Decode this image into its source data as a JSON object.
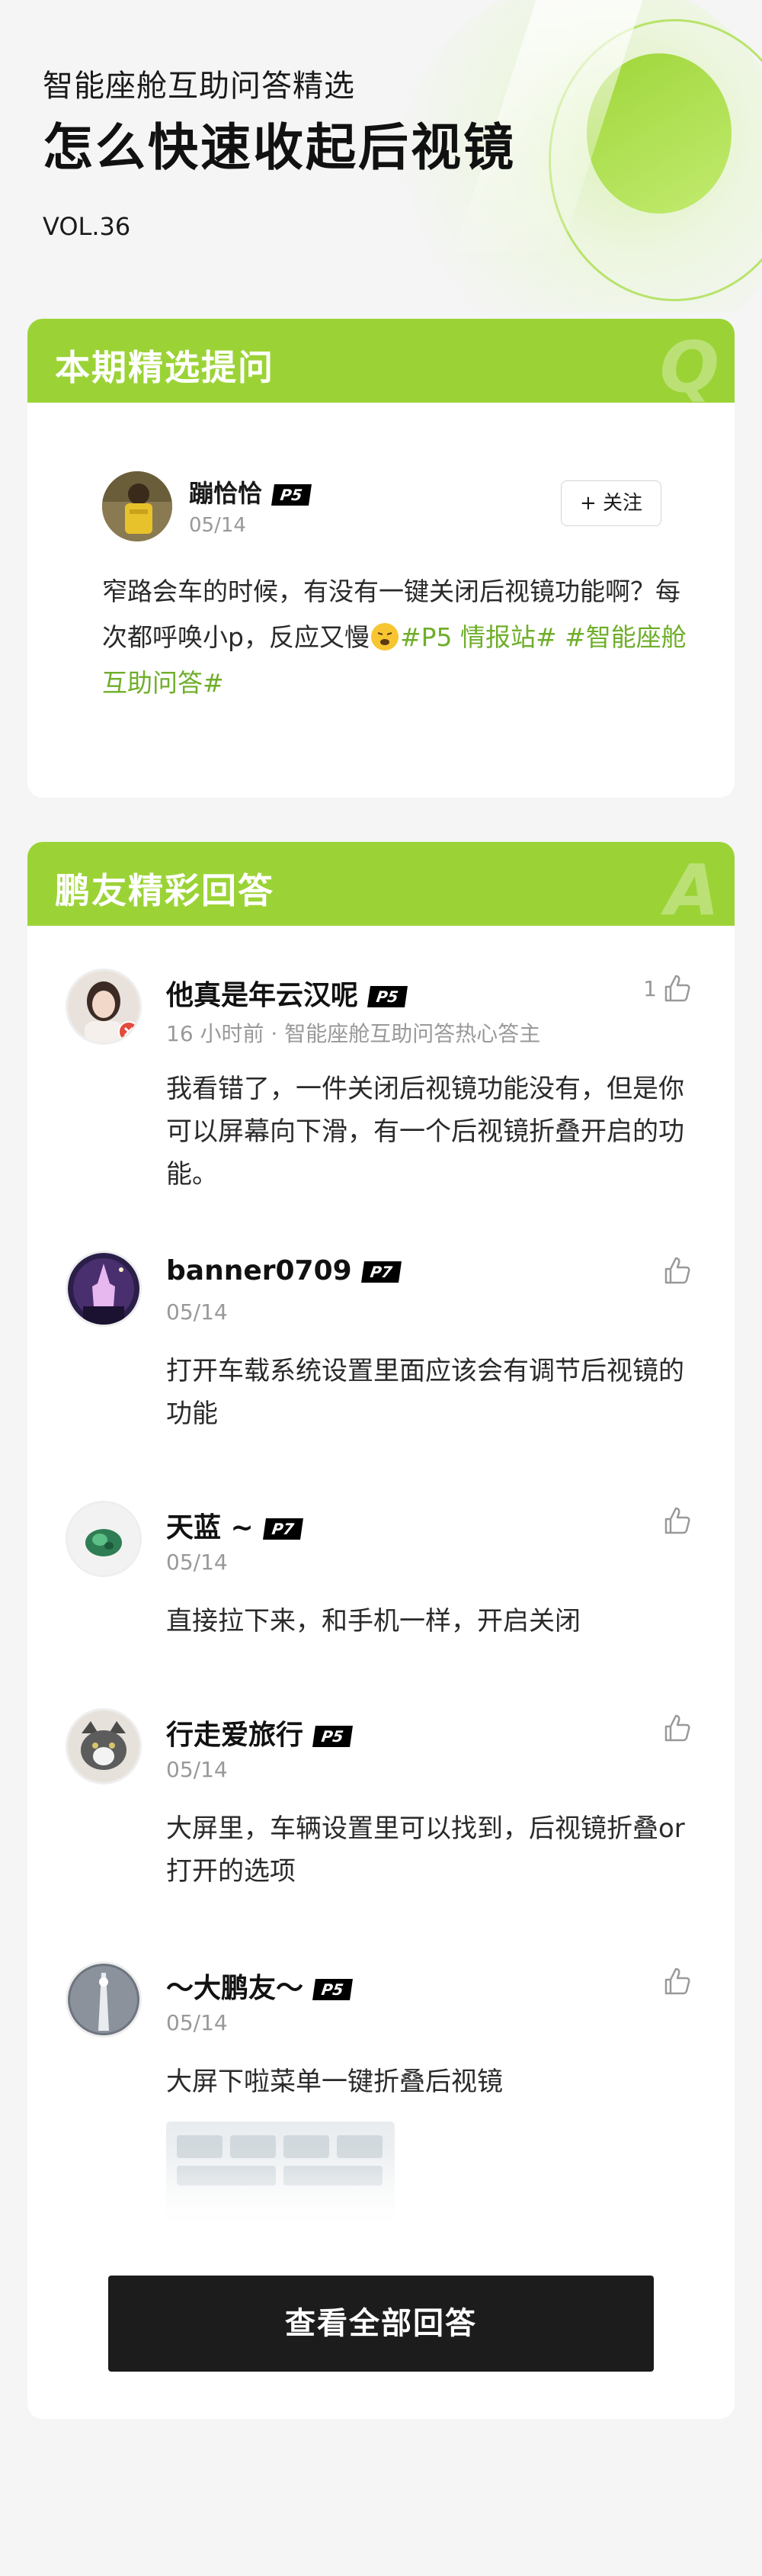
{
  "header": {
    "subtitle": "智能座舱互助问答精选",
    "title": "怎么快速收起后视镜",
    "volume": "VOL.36"
  },
  "question_card": {
    "heading": "本期精选提问",
    "watermark": "Q",
    "author": {
      "name": "蹦恰恰",
      "level": "P5",
      "date": "05/14"
    },
    "follow_label": "+ 关注",
    "text": "窄路会车的时候，有没有一键关闭后视镜功能啊？每次都呼唤小p，反应又慢",
    "tags": "#P5 情报站# #智能座舱互助问答#"
  },
  "answer_card": {
    "heading": "鹏友精彩回答",
    "watermark": "A",
    "answers": [
      {
        "name": "他真是年云汉呢",
        "level": "P5",
        "meta": "16 小时前 · 智能座舱互助问答热心答主",
        "likes": "1",
        "text": "我看错了，一件关闭后视镜功能没有，但是你可以屏幕向下滑，有一个后视镜折叠开启的功能。"
      },
      {
        "name": "banner0709",
        "level": "P7",
        "meta": "05/14",
        "likes": "",
        "text": "打开车载系统设置里面应该会有调节后视镜的功能"
      },
      {
        "name": "天蓝 ~",
        "level": "P7",
        "meta": "05/14",
        "likes": "",
        "text": "直接拉下来，和手机一样，开启关闭"
      },
      {
        "name": "行走爱旅行",
        "level": "P5",
        "meta": "05/14",
        "likes": "",
        "text": "大屏里，车辆设置里可以找到，后视镜折叠or打开的选项"
      },
      {
        "name": "～大鹏友～",
        "level": "P5",
        "meta": "05/14",
        "likes": "",
        "text": "大屏下啦菜单一键折叠后视镜"
      }
    ],
    "view_all_label": "查看全部回答"
  },
  "colors": {
    "brand_green": "#9bd336",
    "tag_green": "#6fae2a",
    "button_dark": "#1c1c1c"
  }
}
